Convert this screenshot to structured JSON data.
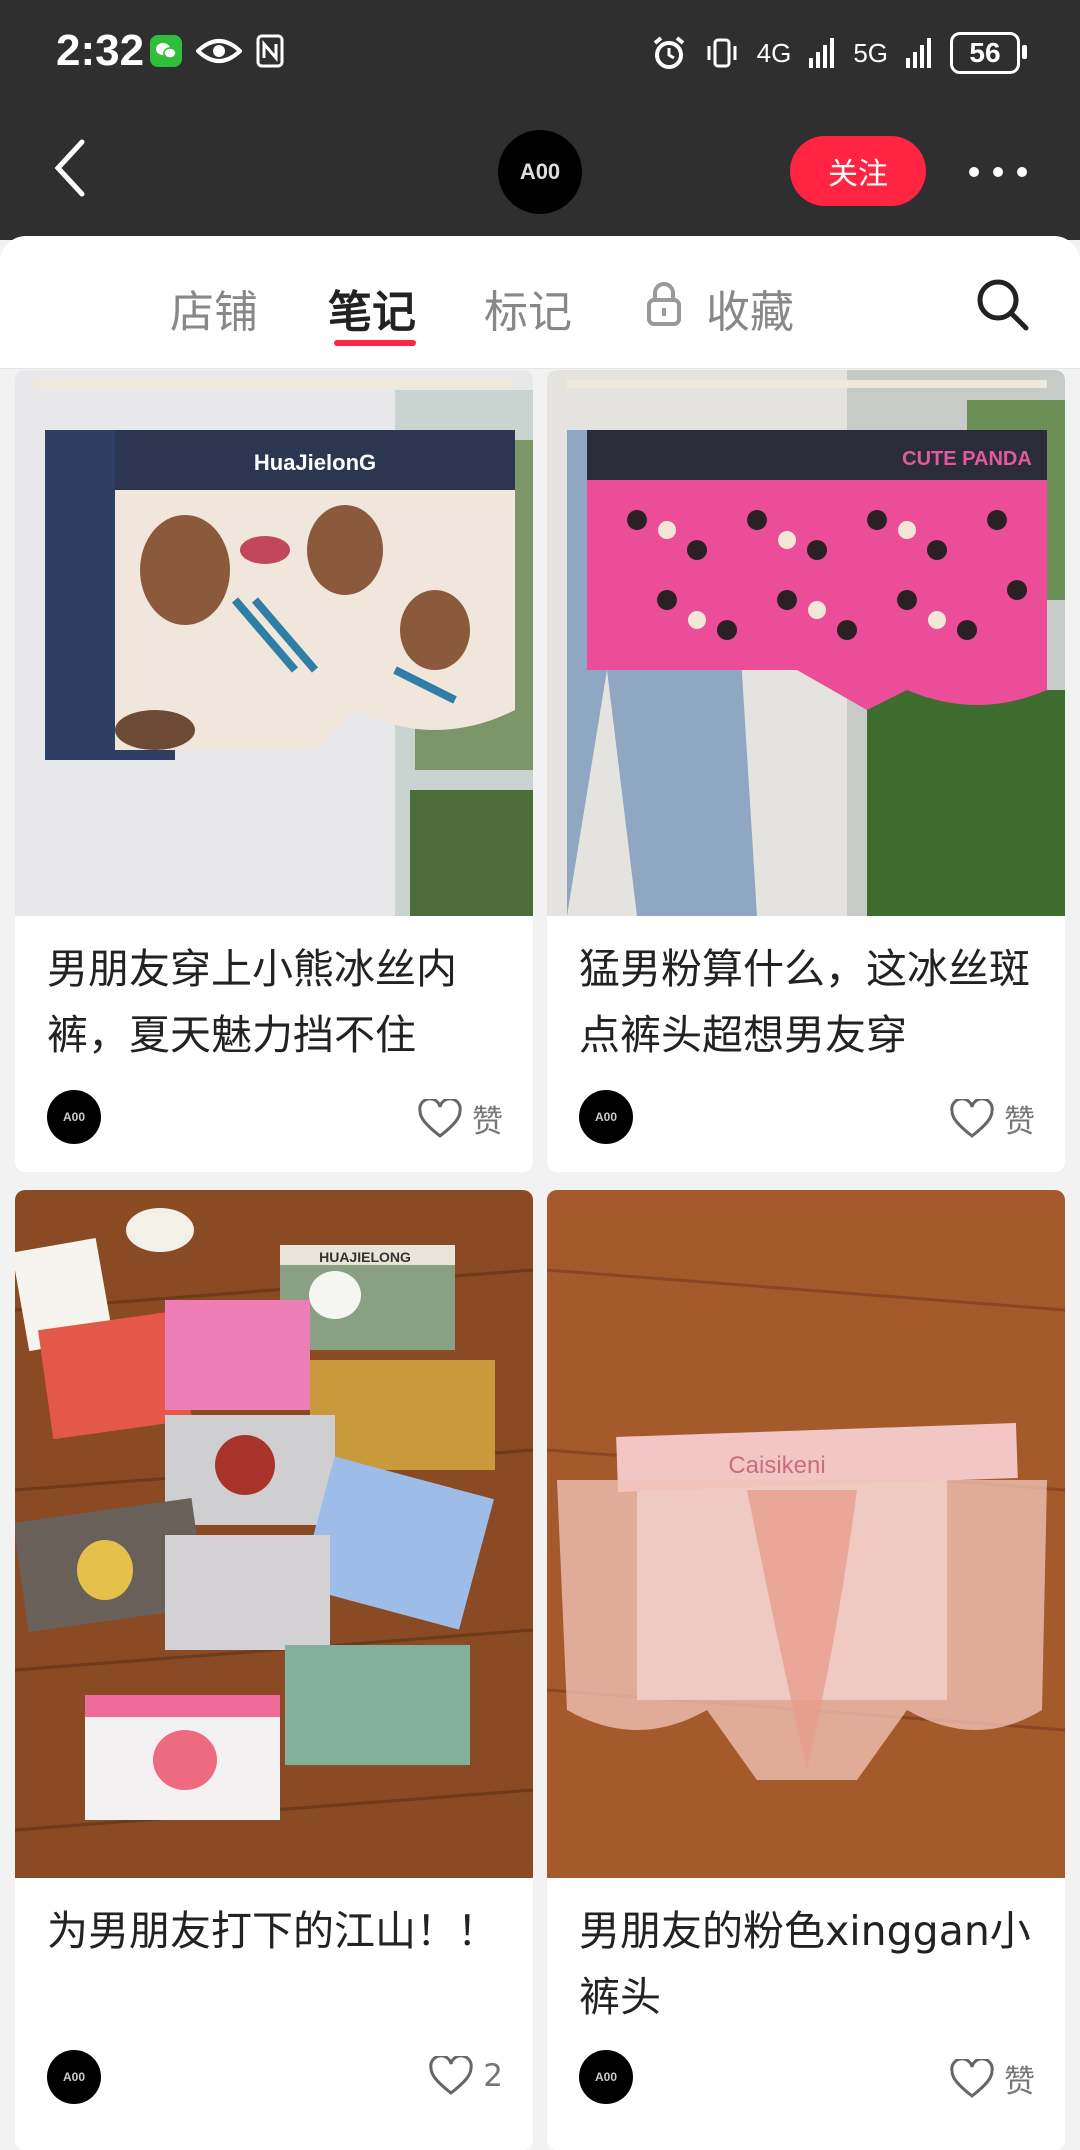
{
  "status_bar": {
    "time": "2:32",
    "network_4g": "4G",
    "network_5g": "5G",
    "battery": "56"
  },
  "nav": {
    "avatar_text": "A00",
    "follow_label": "关注"
  },
  "tabs": {
    "items": [
      "店铺",
      "笔记",
      "标记",
      "收藏"
    ],
    "active": "笔记"
  },
  "feed": [
    {
      "title": "男朋友穿上小熊冰丝内裤，夏天魅力挡不住",
      "like_text": "赞",
      "photo_band_text": "HuaJielonG"
    },
    {
      "title": "猛男粉算什么，这冰丝斑点裤头超想男友穿",
      "like_text": "赞",
      "photo_band_text": "CUTE PANDA"
    },
    {
      "title": "为男朋友打下的江山！！",
      "like_text": "2",
      "photo_band_text": "HUAJIELONG"
    },
    {
      "title": "男朋友的粉色xinggan小裤头",
      "like_text": "赞",
      "photo_band_text": "Caisikeni"
    }
  ],
  "colors": {
    "accent": "#ff2442",
    "topbar": "#2f2f2f"
  }
}
